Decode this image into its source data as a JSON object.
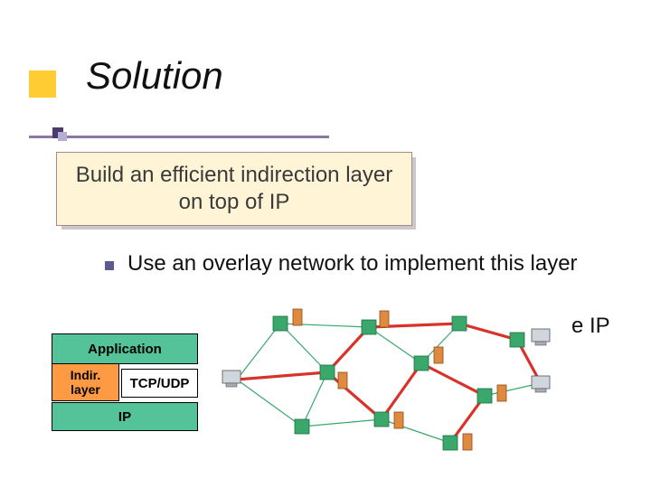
{
  "title": "Solution",
  "callout": {
    "line1": "Build an efficient indirection layer",
    "line2": "on top of IP"
  },
  "bullet": "Use an overlay network to implement this layer",
  "right_fragment": "e IP",
  "stack": {
    "application": "Application",
    "indirection": "Indir. layer",
    "tcp": "TCP/UDP",
    "ip": "IP"
  },
  "icons": {
    "router": "router-node",
    "server": "server-node",
    "workstation": "workstation",
    "link": "network-link",
    "overlay": "overlay-path"
  },
  "colors": {
    "yellow": "#ffcc33",
    "purple_line": "#8a7aa3",
    "purple_dark": "#4b3a6e",
    "purple_light": "#b4aed2",
    "callout_bg": "#fff5d6",
    "stack_green": "#54c39a",
    "stack_orange": "#ff9a44",
    "overlay_red": "#d8322a",
    "node_green": "#3aa86b",
    "server_orange": "#e08a3f"
  }
}
